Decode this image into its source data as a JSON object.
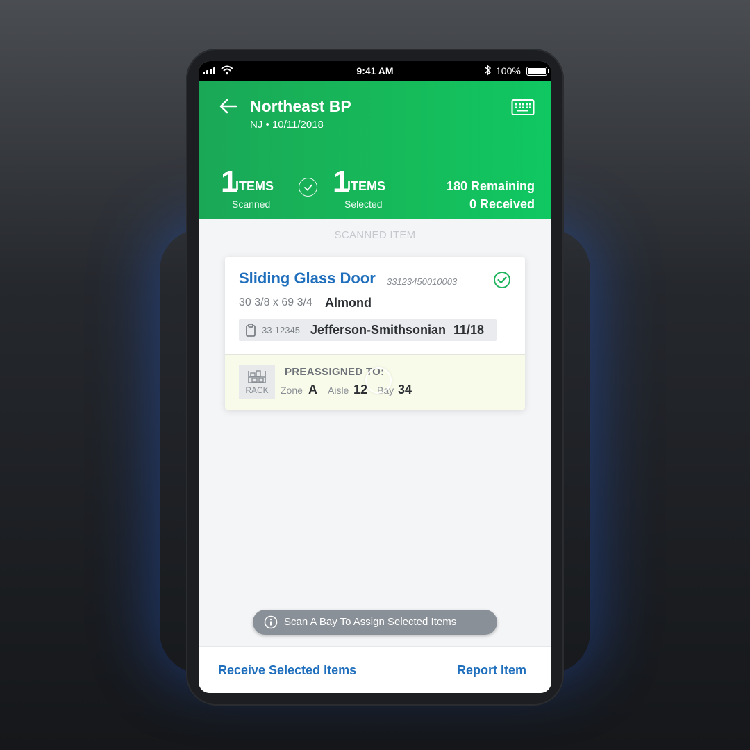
{
  "status_bar": {
    "time": "9:41 AM",
    "battery": "100%"
  },
  "header": {
    "title": "Northeast BP",
    "subtitle": "NJ • 10/11/2018",
    "scanned": {
      "count": "1",
      "unit": "ITEMS",
      "caption": "Scanned"
    },
    "selected": {
      "count": "1",
      "unit": "ITEMS",
      "caption": "Selected"
    },
    "remaining": "180 Remaining",
    "received": "0 Received"
  },
  "section_label": "SCANNED ITEM",
  "item": {
    "name": "Sliding Glass Door",
    "sku": "33123450010003",
    "dimensions": "30 3/8 x 69 3/4",
    "color": "Almond",
    "order_number": "33-12345",
    "order_name": "Jefferson-Smithsonian",
    "order_date": "11/18"
  },
  "preassigned": {
    "rack_label": "RACK",
    "title": "PREASSIGNED TO:",
    "zone_label": "Zone",
    "zone": "A",
    "aisle_label": "Aisle",
    "aisle": "12",
    "bay_label": "Bay",
    "bay": "34"
  },
  "toast": "Scan A Bay To Assign Selected Items",
  "footer": {
    "receive": "Receive Selected Items",
    "report": "Report Item"
  },
  "colors": {
    "brand_green": "#16bb5a",
    "link_blue": "#1f6fbd",
    "preassigned_bg": "#f9fbea"
  },
  "icons": [
    "signal-icon",
    "wifi-icon",
    "bluetooth-icon",
    "battery-icon",
    "back-arrow-icon",
    "keyboard-icon",
    "check-circle-icon",
    "clipboard-icon",
    "rack-icon",
    "info-icon"
  ]
}
